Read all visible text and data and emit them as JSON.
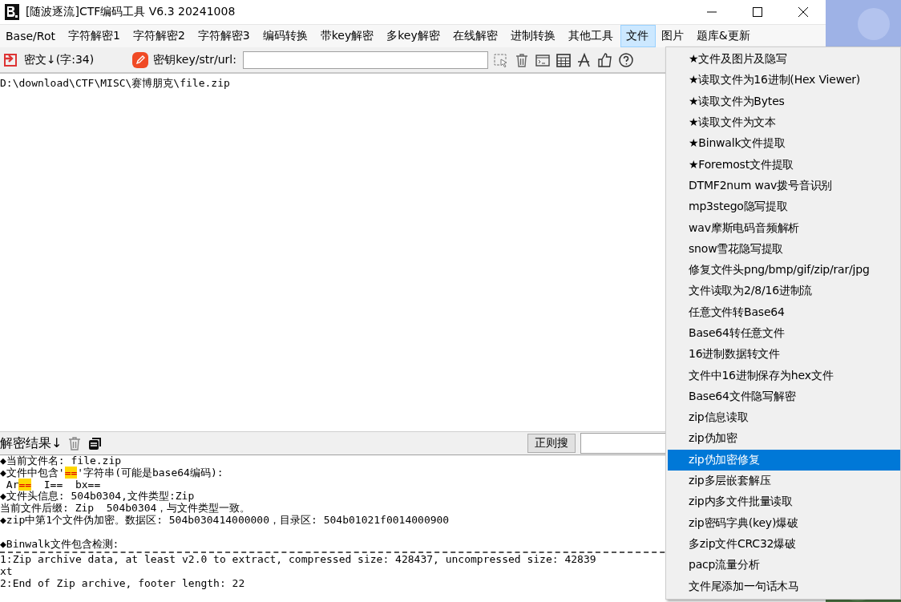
{
  "window": {
    "title": "[随波逐流]CTF编码工具 V6.3 20241008"
  },
  "menu_bar": [
    {
      "label": "Base/Rot",
      "selected": false
    },
    {
      "label": "字符解密1",
      "selected": false
    },
    {
      "label": "字符解密2",
      "selected": false
    },
    {
      "label": "字符解密3",
      "selected": false
    },
    {
      "label": "编码转换",
      "selected": false
    },
    {
      "label": "带key解密",
      "selected": false
    },
    {
      "label": "多key解密",
      "selected": false
    },
    {
      "label": "在线解密",
      "selected": false
    },
    {
      "label": "进制转换",
      "selected": false
    },
    {
      "label": "其他工具",
      "selected": false
    },
    {
      "label": "文件",
      "selected": true
    },
    {
      "label": "图片",
      "selected": false
    },
    {
      "label": "题库&更新",
      "selected": false
    }
  ],
  "toolbar": {
    "cipher_label": "密文↓(字:34)",
    "key_label": "密钥key/str/url:"
  },
  "input_text": "D:\\download\\CTF\\MISC\\赛博朋克\\file.zip",
  "result_bar": {
    "label": "解密结果↓",
    "regex_button": "正则搜"
  },
  "output_lines": [
    {
      "kind": "text",
      "segments": [
        {
          "text": "◆当前文件名: file.zip",
          "highlight": false
        }
      ]
    },
    {
      "kind": "text",
      "segments": [
        {
          "text": "◆文件中包含'",
          "highlight": false
        },
        {
          "text": "==",
          "highlight": true
        },
        {
          "text": "'字符串(可能是base64编码):",
          "highlight": false
        }
      ]
    },
    {
      "kind": "text",
      "segments": [
        {
          "text": " Ar",
          "highlight": false
        },
        {
          "text": "==",
          "highlight": true
        },
        {
          "text": "  I==  bx==",
          "highlight": false
        }
      ]
    },
    {
      "kind": "text",
      "segments": [
        {
          "text": "◆文件头信息: 504b0304,文件类型:Zip",
          "highlight": false
        }
      ]
    },
    {
      "kind": "text",
      "segments": [
        {
          "text": "当前文件后缀: Zip  504b0304，与文件类型一致。",
          "highlight": false
        }
      ]
    },
    {
      "kind": "text",
      "segments": [
        {
          "text": "◆zip中第1个文件伪加密。数据区: 504b030414000000，目录区: 504b01021f0014000900",
          "highlight": false
        }
      ]
    },
    {
      "kind": "blank"
    },
    {
      "kind": "text",
      "segments": [
        {
          "text": "◆Binwalk文件包含检测:",
          "highlight": false
        }
      ]
    },
    {
      "kind": "rule"
    },
    {
      "kind": "text",
      "segments": [
        {
          "text": "1:Zip archive data, at least v2.0 to extract, compressed size: 428437, uncompressed size: 42839",
          "highlight": false
        }
      ]
    },
    {
      "kind": "text",
      "segments": [
        {
          "text": "xt",
          "highlight": false
        }
      ]
    },
    {
      "kind": "text",
      "segments": [
        {
          "text": "2:End of Zip archive, footer length: 22",
          "highlight": false
        }
      ]
    }
  ],
  "dropdown_menu": [
    {
      "label": "★文件及图片及隐写",
      "selected": false
    },
    {
      "label": "★读取文件为16进制(Hex Viewer)",
      "selected": false
    },
    {
      "label": "★读取文件为Bytes",
      "selected": false
    },
    {
      "label": "★读取文件为文本",
      "selected": false
    },
    {
      "label": "★Binwalk文件提取",
      "selected": false
    },
    {
      "label": "★Foremost文件提取",
      "selected": false
    },
    {
      "label": "DTMF2num  wav拨号音识别",
      "selected": false
    },
    {
      "label": "mp3stego隐写提取",
      "selected": false
    },
    {
      "label": "wav摩斯电码音频解析",
      "selected": false
    },
    {
      "label": "snow雪花隐写提取",
      "selected": false
    },
    {
      "label": "修复文件头png/bmp/gif/zip/rar/jpg",
      "selected": false
    },
    {
      "label": "文件读取为2/8/16进制流",
      "selected": false
    },
    {
      "label": "任意文件转Base64",
      "selected": false
    },
    {
      "label": "Base64转任意文件",
      "selected": false
    },
    {
      "label": "16进制数据转文件",
      "selected": false
    },
    {
      "label": "文件中16进制保存为hex文件",
      "selected": false
    },
    {
      "label": "Base64文件隐写解密",
      "selected": false
    },
    {
      "label": "zip信息读取",
      "selected": false
    },
    {
      "label": "zip伪加密",
      "selected": false
    },
    {
      "label": "zip伪加密修复",
      "selected": true
    },
    {
      "label": "zip多层嵌套解压",
      "selected": false
    },
    {
      "label": "zip内多文件批量读取",
      "selected": false
    },
    {
      "label": "zip密码字典(key)爆破",
      "selected": false
    },
    {
      "label": "多zip文件CRC32爆破",
      "selected": false
    },
    {
      "label": "pacp流量分析",
      "selected": false
    },
    {
      "label": "文件尾添加一句话木马",
      "selected": false
    }
  ]
}
